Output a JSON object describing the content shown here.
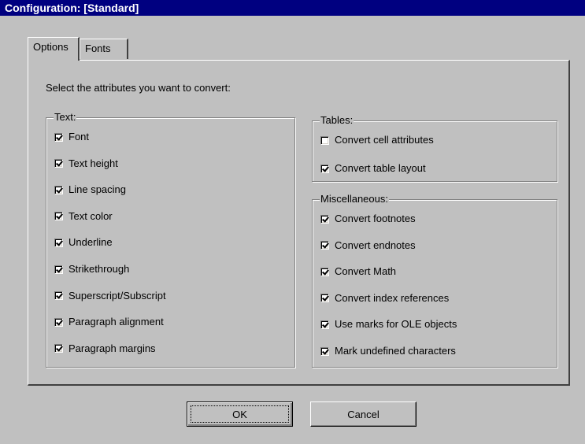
{
  "window": {
    "title": "Configuration: [Standard]"
  },
  "tabs": [
    {
      "label": "Options",
      "active": true
    },
    {
      "label": "Fonts",
      "active": false
    }
  ],
  "intro": "Select the attributes you want to convert:",
  "text_group": {
    "title": "Text:",
    "items": [
      {
        "label": "Font",
        "checked": true
      },
      {
        "label": "Text height",
        "checked": true
      },
      {
        "label": "Line spacing",
        "checked": true
      },
      {
        "label": "Text color",
        "checked": true
      },
      {
        "label": "Underline",
        "checked": true
      },
      {
        "label": "Strikethrough",
        "checked": true
      },
      {
        "label": "Superscript/Subscript",
        "checked": true
      },
      {
        "label": "Paragraph alignment",
        "checked": true
      },
      {
        "label": "Paragraph margins",
        "checked": true
      }
    ]
  },
  "tables_group": {
    "title": "Tables:",
    "items": [
      {
        "label": "Convert cell attributes",
        "checked": false
      },
      {
        "label": "Convert table layout",
        "checked": true
      }
    ]
  },
  "misc_group": {
    "title": "Miscellaneous:",
    "items": [
      {
        "label": "Convert footnotes",
        "checked": true
      },
      {
        "label": "Convert endnotes",
        "checked": true
      },
      {
        "label": "Convert Math",
        "checked": true
      },
      {
        "label": "Convert index references",
        "checked": true
      },
      {
        "label": "Use marks for OLE objects",
        "checked": true
      },
      {
        "label": "Mark undefined characters",
        "checked": true
      }
    ]
  },
  "buttons": {
    "ok": "OK",
    "cancel": "Cancel"
  },
  "colors": {
    "titlebar": "#000080",
    "face": "#c0c0c0"
  }
}
